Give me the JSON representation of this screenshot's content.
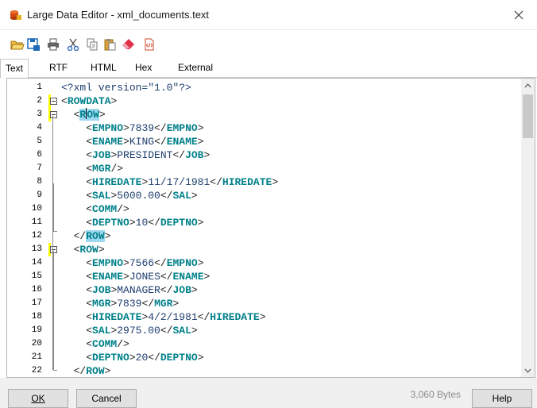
{
  "window": {
    "title": "Large Data Editor - xml_documents.text",
    "close_icon": "close-icon"
  },
  "toolbar": {
    "buttons": [
      {
        "name": "open-folder-icon",
        "color": "#e0a020"
      },
      {
        "name": "save-icon",
        "color": "#1e6bb8"
      },
      {
        "name": "print-icon",
        "color": "#555555"
      },
      {
        "name": "cut-icon",
        "color": "#3a6fc0"
      },
      {
        "name": "copy-icon",
        "color": "#777777"
      },
      {
        "name": "paste-icon",
        "color": "#c08020"
      },
      {
        "name": "eraser-icon",
        "color": "#e0304a"
      },
      {
        "name": "format-xml-icon",
        "color": "#d04020"
      }
    ]
  },
  "tabs": [
    {
      "label": "Text",
      "active": true
    },
    {
      "label": "RTF",
      "active": false
    },
    {
      "label": "HTML",
      "active": false
    },
    {
      "label": "Hex",
      "active": false
    },
    {
      "label": "External",
      "active": false
    }
  ],
  "editor": {
    "lines": [
      {
        "n": "1",
        "text": "<?xml version=\"1.0\"?>"
      },
      {
        "n": "2",
        "text": "<ROWDATA>"
      },
      {
        "n": "3",
        "text": "  <ROW>"
      },
      {
        "n": "4",
        "text": "    <EMPNO>7839</EMPNO>"
      },
      {
        "n": "5",
        "text": "    <ENAME>KING</ENAME>"
      },
      {
        "n": "6",
        "text": "    <JOB>PRESIDENT</JOB>"
      },
      {
        "n": "7",
        "text": "    <MGR/>"
      },
      {
        "n": "8",
        "text": "    <HIREDATE>11/17/1981</HIREDATE>"
      },
      {
        "n": "9",
        "text": "    <SAL>5000.00</SAL>"
      },
      {
        "n": "10",
        "text": "    <COMM/>"
      },
      {
        "n": "11",
        "text": "    <DEPTNO>10</DEPTNO>"
      },
      {
        "n": "12",
        "text": "  </ROW>"
      },
      {
        "n": "13",
        "text": "  <ROW>"
      },
      {
        "n": "14",
        "text": "    <EMPNO>7566</EMPNO>"
      },
      {
        "n": "15",
        "text": "    <ENAME>JONES</ENAME>"
      },
      {
        "n": "16",
        "text": "    <JOB>MANAGER</JOB>"
      },
      {
        "n": "17",
        "text": "    <MGR>7839</MGR>"
      },
      {
        "n": "18",
        "text": "    <HIREDATE>4/2/1981</HIREDATE>"
      },
      {
        "n": "19",
        "text": "    <SAL>2975.00</SAL>"
      },
      {
        "n": "20",
        "text": "    <COMM/>"
      },
      {
        "n": "21",
        "text": "    <DEPTNO>20</DEPTNO>"
      },
      {
        "n": "22",
        "text": "  </ROW>"
      }
    ]
  },
  "footer": {
    "ok_label": "OK",
    "cancel_label": "Cancel",
    "size_text": "3,060 Bytes",
    "help_label": "Help"
  }
}
